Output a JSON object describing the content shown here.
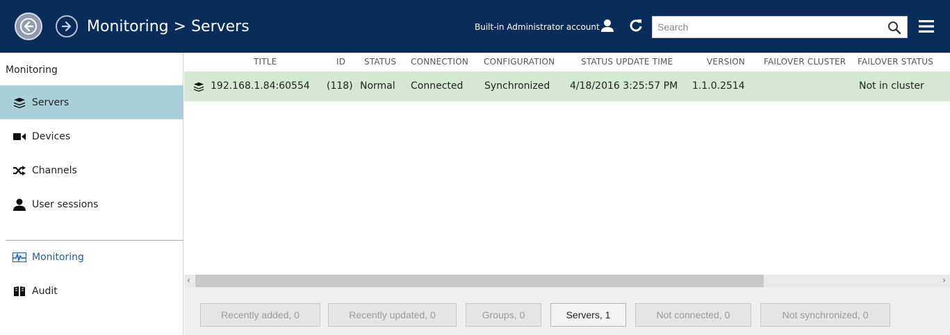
{
  "header": {
    "title": "Monitoring > Servers",
    "account_label": "Built-in Administrator account",
    "search_placeholder": "Search"
  },
  "sidebar": {
    "heading": "Monitoring",
    "items": [
      {
        "label": "Servers",
        "icon": "stack-icon",
        "active": true
      },
      {
        "label": "Devices",
        "icon": "camera-icon",
        "active": false
      },
      {
        "label": "Channels",
        "icon": "shuffle-icon",
        "active": false
      },
      {
        "label": "User sessions",
        "icon": "user-icon",
        "active": false
      }
    ],
    "bottom_items": [
      {
        "label": "Monitoring",
        "icon": "monitoring-icon",
        "selected": true
      },
      {
        "label": "Audit",
        "icon": "book-icon",
        "selected": false
      }
    ]
  },
  "table": {
    "columns": [
      "TITLE",
      "ID",
      "STATUS",
      "CONNECTION",
      "CONFIGURATION",
      "STATUS UPDATE TIME",
      "VERSION",
      "FAILOVER CLUSTER",
      "FAILOVER STATUS"
    ],
    "rows": [
      {
        "title": "192.168.1.84:60554",
        "id": "(118)",
        "status": "Normal",
        "connection": "Connected",
        "configuration": "Synchronized",
        "status_update_time": "4/18/2016 3:25:57 PM",
        "version": "1.1.0.2514",
        "failover_cluster": "",
        "failover_status": "Not in cluster"
      }
    ]
  },
  "filters": [
    {
      "label": "Recently added, 0",
      "active": false
    },
    {
      "label": "Recently updated, 0",
      "active": false
    },
    {
      "label": "Groups, 0",
      "active": false
    },
    {
      "label": "Servers, 1",
      "active": true
    },
    {
      "label": "Not connected, 0",
      "active": false
    },
    {
      "label": "Not synchronized, 0",
      "active": false
    }
  ],
  "colors": {
    "header_bg": "#0a2c5a",
    "active_nav_bg": "#a9cfd9",
    "row_highlight": "#d4e8d4",
    "link_blue": "#1c5fa6"
  }
}
